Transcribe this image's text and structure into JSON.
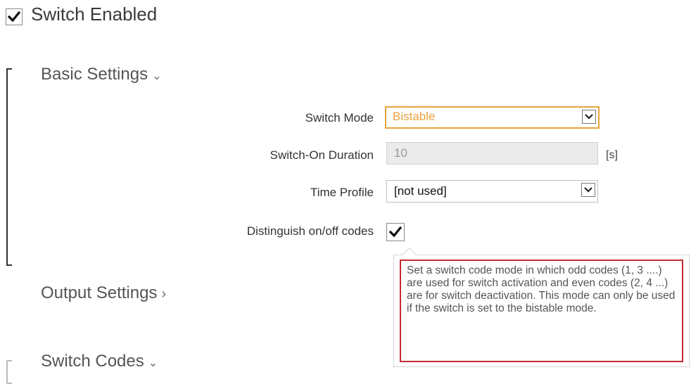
{
  "switch_enabled": {
    "label": "Switch Enabled",
    "checked": true
  },
  "sections": {
    "basic": {
      "title": "Basic Settings",
      "chevron": "⌄"
    },
    "output": {
      "title": "Output Settings",
      "chevron": "›"
    },
    "codes": {
      "title": "Switch Codes",
      "chevron": "⌄"
    }
  },
  "fields": {
    "switch_mode": {
      "label": "Switch Mode",
      "value": "Bistable"
    },
    "switch_on_duration": {
      "label": "Switch-On Duration",
      "value": "10",
      "unit": "[s]"
    },
    "time_profile": {
      "label": "Time Profile",
      "value": "[not used]"
    },
    "distinguish_codes": {
      "label": "Distinguish on/off codes",
      "checked": true
    }
  },
  "tooltip": {
    "text": "Set a switch code mode in which odd codes (1, 3 ....) are used for switch activation and even codes (2, 4 ...) are for switch deactivation. This mode can only be used if the switch is set to the bistable mode."
  },
  "colors": {
    "focus_border": "#e8a33d",
    "focus_text": "#e8a33d",
    "tooltip_border": "#c42b33"
  },
  "icons": [
    "checkmark-icon",
    "dropdown-arrow-icon",
    "chevron-icon"
  ]
}
